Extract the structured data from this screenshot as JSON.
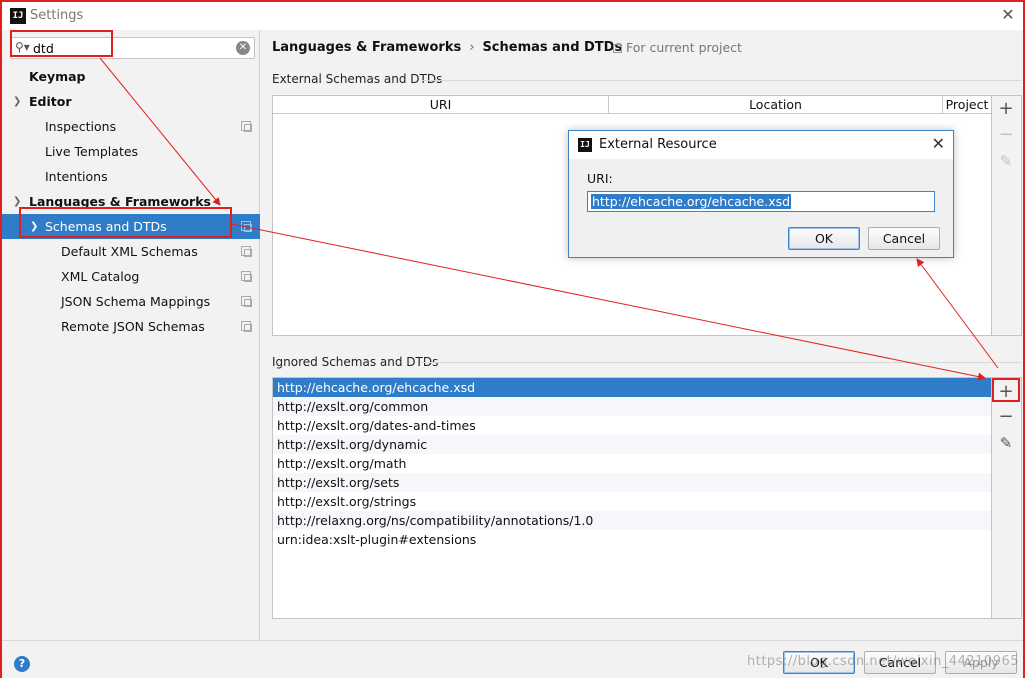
{
  "window": {
    "title": "Settings",
    "logo_text": "IJ",
    "close_glyph": "✕"
  },
  "search": {
    "value": "dtd",
    "icon": "search-icon",
    "clear_glyph": "✕"
  },
  "tree": [
    {
      "label": "Keymap",
      "bold": true,
      "expanded": null
    },
    {
      "label": "Editor",
      "bold": true,
      "expanded": true
    },
    {
      "label": "Inspections",
      "bold": false
    },
    {
      "label": "Live Templates",
      "bold": false
    },
    {
      "label": "Intentions",
      "bold": false
    },
    {
      "label": "Languages & Frameworks",
      "bold": true,
      "expanded": true
    },
    {
      "label": "Schemas and DTDs",
      "bold": false,
      "selected": true,
      "expanded": true
    },
    {
      "label": "Default XML Schemas",
      "bold": false
    },
    {
      "label": "XML Catalog",
      "bold": false
    },
    {
      "label": "JSON Schema Mappings",
      "bold": false
    },
    {
      "label": "Remote JSON Schemas",
      "bold": false
    }
  ],
  "breadcrumb": {
    "parent": "Languages & Frameworks",
    "separator": "›",
    "current": "Schemas and DTDs",
    "scope": "For current project"
  },
  "external": {
    "section_label": "External Schemas and DTDs",
    "columns": [
      "URI",
      "Location",
      "Project"
    ]
  },
  "ignored": {
    "section_label": "Ignored Schemas and DTDs",
    "rows": [
      "http://ehcache.org/ehcache.xsd",
      "http://exslt.org/common",
      "http://exslt.org/dates-and-times",
      "http://exslt.org/dynamic",
      "http://exslt.org/math",
      "http://exslt.org/sets",
      "http://exslt.org/strings",
      "http://relaxng.org/ns/compatibility/annotations/1.0",
      "urn:idea:xslt-plugin#extensions"
    ],
    "selected_index": 0
  },
  "toolbar": {
    "add_glyph": "+",
    "remove_glyph": "−",
    "edit_glyph": "✎"
  },
  "dialog": {
    "title": "External Resource",
    "logo_text": "IJ",
    "close_glyph": "✕",
    "uri_label": "URI:",
    "uri_value": "http://ehcache.org/ehcache.xsd",
    "ok_label": "OK",
    "cancel_label": "Cancel"
  },
  "footer": {
    "help_glyph": "?",
    "ok_label": "OK",
    "cancel_label": "Cancel",
    "apply_label": "Apply",
    "watermark": "https://blog.csdn.net/weixin_44210965"
  },
  "colors": {
    "selection": "#2f7dc9",
    "annotation": "#e02020",
    "panel": "#f2f2f2"
  }
}
